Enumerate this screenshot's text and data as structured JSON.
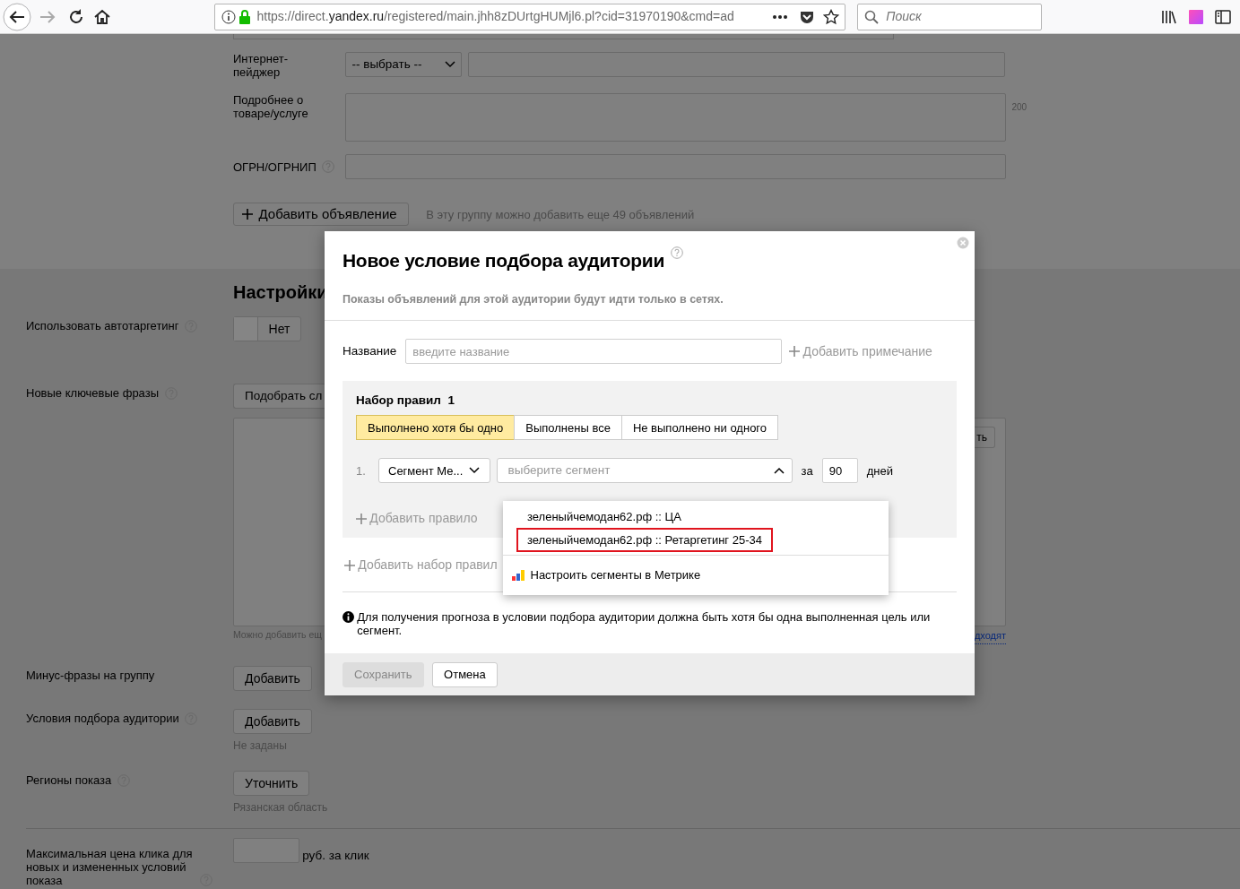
{
  "browser": {
    "url_prefix": "https://direct.",
    "url_host": "yandex.ru",
    "url_rest": "/registered/main.jhh8zDUrtgHUMjl6.pl?cid=31970190&cmd=ad",
    "search_placeholder": "Поиск"
  },
  "ad_form": {
    "pager_label": "Интернет-пейджер",
    "pager_select": "-- выбрать --",
    "details_label": "Подробнее о товаре/услуге",
    "details_counter": "200",
    "ogrn_label": "ОГРН/ОГРНИП",
    "add_ad_button": "Добавить объявление",
    "add_ad_note": "В эту группу можно добавить еще 49 объявлений"
  },
  "settings": {
    "heading": "Настройки",
    "autotargeting": {
      "label": "Использовать автотаргетинг",
      "toggle_text": "Нет",
      "on": false
    },
    "keywords": {
      "label": "Новые ключевые фразы",
      "pick_button": "Подобрать сл",
      "side_button": "ть",
      "hint": "Можно добавить ещ",
      "link": "дходят"
    },
    "minus": {
      "label": "Минус-фразы на группу",
      "button": "Добавить"
    },
    "audience": {
      "label": "Условия подбора аудитории",
      "button": "Добавить",
      "note": "Не заданы"
    },
    "regions": {
      "label": "Регионы показа",
      "button": "Уточнить",
      "note": "Рязанская область"
    },
    "max_price": {
      "label": "Максимальная цена клика для новых и измененных условий показа",
      "unit": "руб. за клик"
    }
  },
  "modal": {
    "title": "Новое условие подбора аудитории",
    "subtitle": "Показы объявлений для этой аудитории будут идти только в сетях.",
    "name_label": "Название",
    "name_placeholder": "введите название",
    "add_note": "Добавить примечание",
    "ruleset": {
      "title": "Набор правил  1",
      "modes": [
        {
          "label": "Выполнено хотя бы одно",
          "selected": true
        },
        {
          "label": "Выполнены все",
          "selected": false
        },
        {
          "label": "Не выполнено ни одного",
          "selected": false
        }
      ],
      "rule": {
        "number": "1.",
        "type": "Сегмент Ме...",
        "segment_placeholder": "выберите сегмент",
        "expanded": true,
        "for": "за",
        "days": "90",
        "days_label": "дней"
      },
      "add_rule": "Добавить правило"
    },
    "add_ruleset": "Добавить набор правил",
    "dropdown": {
      "items": [
        {
          "label": "зеленыйчемодан62.рф :: ЦА",
          "highlighted": false
        },
        {
          "label": "зеленыйчемодан62.рф :: Ретаргетинг 25-34",
          "highlighted": true
        }
      ],
      "metrika_link": "Настроить сегменты в Метрике"
    },
    "info": "Для получения прогноза в условии подбора аудитории должна быть хотя бы одна выполненная цель или сегмент.",
    "buttons": [
      {
        "label": "Сохранить",
        "disabled": true
      },
      {
        "label": "Отмена",
        "disabled": false
      }
    ]
  }
}
